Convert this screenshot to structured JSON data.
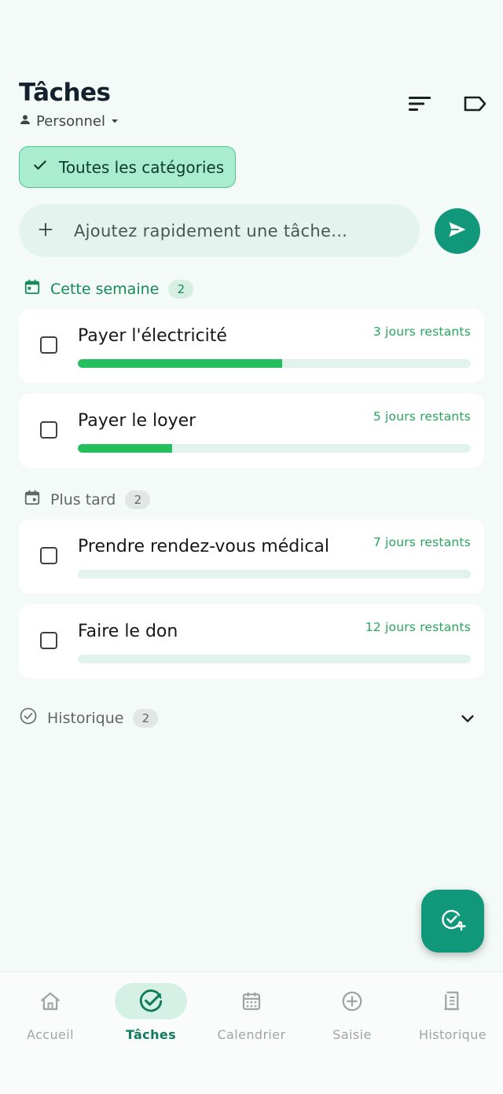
{
  "header": {
    "title": "Tâches",
    "profile": "Personnel",
    "icons": [
      "sort-icon",
      "label-icon"
    ]
  },
  "filter_chip": {
    "label": "Toutes les catégories"
  },
  "quick_add": {
    "placeholder": "Ajoutez rapidement une tâche..."
  },
  "sections": {
    "this_week": {
      "label": "Cette semaine",
      "count": "2"
    },
    "later": {
      "label": "Plus tard",
      "count": "2"
    },
    "history": {
      "label": "Historique",
      "count": "2"
    }
  },
  "tasks": [
    {
      "title": "Payer l'électricité",
      "remaining": "3 jours restants",
      "progress": 0.52
    },
    {
      "title": "Payer le loyer",
      "remaining": "5 jours restants",
      "progress": 0.24
    },
    {
      "title": "Prendre rendez-vous médical",
      "remaining": "7 jours restants",
      "progress": 0.0
    },
    {
      "title": "Faire le don",
      "remaining": "12 jours restants",
      "progress": 0.0
    }
  ],
  "nav": {
    "items": [
      {
        "label": "Accueil",
        "icon": "home-icon"
      },
      {
        "label": "Tâches",
        "icon": "check-circle-icon",
        "active": true
      },
      {
        "label": "Calendrier",
        "icon": "calendar-icon"
      },
      {
        "label": "Saisie",
        "icon": "plus-circle-icon"
      },
      {
        "label": "Historique",
        "icon": "receipt-icon"
      }
    ]
  },
  "colors": {
    "accent": "#11977a",
    "progress": "#25bf5e",
    "chip_bg": "#a9ecd0",
    "background": "#f3faf7"
  }
}
